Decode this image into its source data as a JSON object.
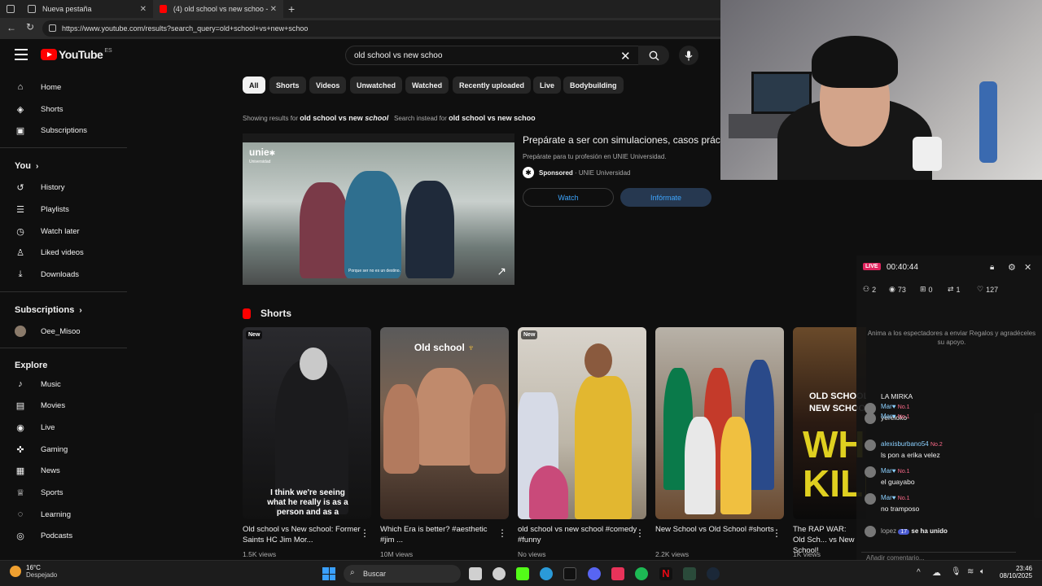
{
  "browser": {
    "tabs": [
      {
        "title": "Nueva pestaña"
      },
      {
        "title": "(4) old school vs new schoo - You"
      }
    ],
    "url": "https://www.youtube.com/results?search_query=old+school+vs+new+schoo"
  },
  "header": {
    "logo_text": "YouTube",
    "logo_country": "ES",
    "search_value": "old school vs new schoo"
  },
  "sidebar": {
    "main": [
      {
        "label": "Home",
        "icon": "home-icon"
      },
      {
        "label": "Shorts",
        "icon": "shorts-icon"
      },
      {
        "label": "Subscriptions",
        "icon": "subscriptions-icon"
      }
    ],
    "you_heading": "You",
    "you": [
      {
        "label": "History",
        "icon": "history-icon"
      },
      {
        "label": "Playlists",
        "icon": "playlists-icon"
      },
      {
        "label": "Watch later",
        "icon": "clock-icon"
      },
      {
        "label": "Liked videos",
        "icon": "thumbs-up-icon"
      },
      {
        "label": "Downloads",
        "icon": "download-icon"
      }
    ],
    "subs_heading": "Subscriptions",
    "subs": [
      {
        "label": "Oee_Misoo"
      }
    ],
    "explore_heading": "Explore",
    "explore": [
      {
        "label": "Music",
        "icon": "music-icon"
      },
      {
        "label": "Movies",
        "icon": "movies-icon"
      },
      {
        "label": "Live",
        "icon": "live-icon"
      },
      {
        "label": "Gaming",
        "icon": "gaming-icon"
      },
      {
        "label": "News",
        "icon": "news-icon"
      },
      {
        "label": "Sports",
        "icon": "sports-icon"
      },
      {
        "label": "Learning",
        "icon": "learning-icon"
      },
      {
        "label": "Podcasts",
        "icon": "podcasts-icon"
      }
    ]
  },
  "chips": [
    "All",
    "Shorts",
    "Videos",
    "Unwatched",
    "Watched",
    "Recently uploaded",
    "Live",
    "Bodybuilding"
  ],
  "results": {
    "showing_prefix": "Showing results for",
    "showing_query_a": "old school vs new",
    "showing_query_b": "school",
    "instead_prefix": "Search instead for",
    "instead_query": "old school vs new schoo"
  },
  "ad": {
    "title": "Prepárate a ser con simulaciones, casos práct",
    "subtitle": "Prepárate para tu profesión en UNIE Universidad.",
    "sponsored": "Sponsored",
    "advertiser": "UNIE Universidad",
    "watch_label": "Watch",
    "cta_label": "Infórmate",
    "thumb_logo": "unie",
    "thumb_logo_sub": "Universidad",
    "thumb_caption": "Porque ser no es un destino."
  },
  "shorts": {
    "heading": "Shorts",
    "items": [
      {
        "title": "Old school vs New school: Former Saints HC Jim Mor...",
        "views": "1.5K views",
        "badge": "New",
        "overlay": "I think we're seeing what he really is as a person and as a"
      },
      {
        "title": "Which Era is better? #aesthetic #jim ...",
        "views": "10M views",
        "badge": "",
        "overlay": "Old school"
      },
      {
        "title": "old school vs new school #comedy #funny",
        "views": "No views",
        "badge": "New",
        "overlay": ""
      },
      {
        "title": "New School vs Old School #shorts",
        "views": "2.2K views",
        "badge": "",
        "overlay": ""
      },
      {
        "title": "The RAP WAR: Old Sch... vs New School!",
        "views": "1K views",
        "badge": "",
        "overlay": "OLD SCHOOL OR NEW SCHOOL?"
      }
    ]
  },
  "stream": {
    "live_label": "LIVE",
    "time": "00:40:44",
    "stats": [
      {
        "icon": "users-icon",
        "value": "2"
      },
      {
        "icon": "eye-icon",
        "value": "73"
      },
      {
        "icon": "gift-icon",
        "value": "0"
      },
      {
        "icon": "share-icon",
        "value": "1"
      },
      {
        "icon": "heart-icon",
        "value": "127"
      }
    ],
    "hint": "Anima a los espectadores a enviar Regalos y agradéceles su apoyo.",
    "chat": [
      {
        "name": "LA MIRKA",
        "badge": "",
        "msg": ""
      },
      {
        "name": "Mar♥",
        "badge": "No.1",
        "msg": "yereloko"
      },
      {
        "name": "Mar♥",
        "badge": "No.1",
        "msg": ""
      },
      {
        "name": "alexisburbano54",
        "badge": "No.2",
        "msg": "ls pon a erika velez"
      },
      {
        "name": "Mar♥",
        "badge": "No.1",
        "msg": "el guayabo"
      },
      {
        "name": "Mar♥",
        "badge": "No.1",
        "msg": "no tramposo"
      }
    ],
    "joined_name": "lopez",
    "joined_badge": "17",
    "joined_text": "se ha unido",
    "comment_placeholder": "Añadir comentario..."
  },
  "taskbar": {
    "weather_temp": "16°C",
    "weather_desc": "Despejado",
    "search_label": "Buscar",
    "time": "23:46",
    "date": "08/10/2025"
  }
}
